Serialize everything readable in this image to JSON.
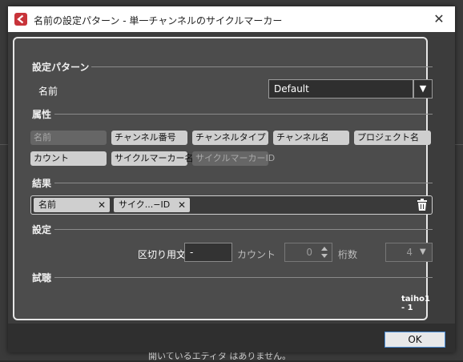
{
  "background": {
    "status_text": "開いているエディタ はありません。"
  },
  "window": {
    "title": "名前の設定パターン - 単一チャンネルのサイクルマーカー",
    "close": "✕"
  },
  "pattern": {
    "section": "設定パターン",
    "name_label": "名前",
    "name_value": "Default",
    "dropdown": "▼"
  },
  "attributes": {
    "section": "属性",
    "chips": [
      {
        "label": "名前",
        "enabled": false
      },
      {
        "label": "チャンネル番号",
        "enabled": true
      },
      {
        "label": "チャンネルタイプ",
        "enabled": true
      },
      {
        "label": "チャンネル名",
        "enabled": true
      },
      {
        "label": "プロジェクト名",
        "enabled": true
      },
      {
        "label": "カウント",
        "enabled": true
      },
      {
        "label": "サイクルマーカー名",
        "enabled": true
      },
      {
        "label": "サイクルマーカーID",
        "enabled": false
      }
    ]
  },
  "results": {
    "section": "結果",
    "tags": [
      "名前",
      "サイク...−ID"
    ],
    "remove": "✕"
  },
  "settings": {
    "section": "設定",
    "separator_label": "区切り用文...",
    "separator_value": "-",
    "count_label": "カウント",
    "count_value": "0",
    "digits_label": "桁数",
    "digits_value": "4",
    "dropdown": "▼"
  },
  "preview": {
    "section": "試聴",
    "value": "taiho1 - 1"
  },
  "footer": {
    "ok_label": "OK"
  },
  "colors": {
    "accent": "#4d90d9",
    "panel": "#4c4c4c",
    "chip": "#cfcfcf",
    "icon_red": "#c8343a"
  }
}
